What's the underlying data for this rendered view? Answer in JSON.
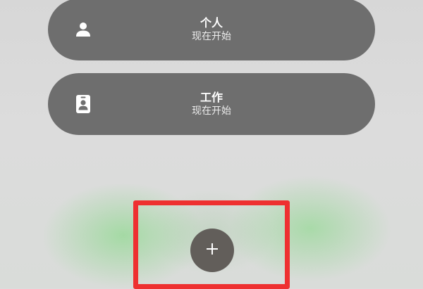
{
  "profiles": [
    {
      "title": "个人",
      "subtitle": "现在开始",
      "icon": "person-icon"
    },
    {
      "title": "工作",
      "subtitle": "现在开始",
      "icon": "id-badge-icon"
    }
  ],
  "add_button": {
    "icon": "plus-icon"
  },
  "colors": {
    "card_background": "#6e6e6e",
    "add_button_background": "#625e5a",
    "highlight_border": "#ee3030",
    "glow_green": "#78d778"
  }
}
